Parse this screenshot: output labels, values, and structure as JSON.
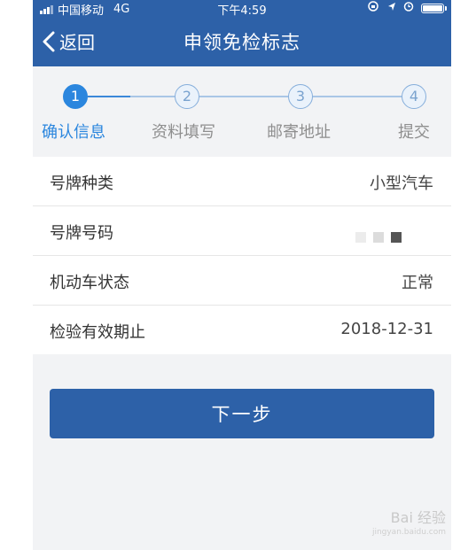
{
  "status_bar": {
    "carrier": "中国移动",
    "network": "4G",
    "time": "下午4:59"
  },
  "nav": {
    "back_label": "返回",
    "title": "申领免检标志"
  },
  "steps": [
    {
      "number": "1",
      "label": "确认信息",
      "state": "active"
    },
    {
      "number": "2",
      "label": "资料填写",
      "state": "todo"
    },
    {
      "number": "3",
      "label": "邮寄地址",
      "state": "todo"
    },
    {
      "number": "4",
      "label": "提交",
      "state": "todo"
    }
  ],
  "info_rows": [
    {
      "label": "号牌种类",
      "value": "小型汽车"
    },
    {
      "label": "号牌号码",
      "value": ""
    },
    {
      "label": "机动车状态",
      "value": "正常"
    },
    {
      "label": "检验有效期止",
      "value": "2018-12-31"
    }
  ],
  "next_button_label": "下一步",
  "watermark": {
    "text": "Bai 经验",
    "sub": "jingyan.baidu.com"
  },
  "colors": {
    "primary": "#2d61a8",
    "step_active": "#2b86de",
    "background": "#f2f3f5"
  }
}
